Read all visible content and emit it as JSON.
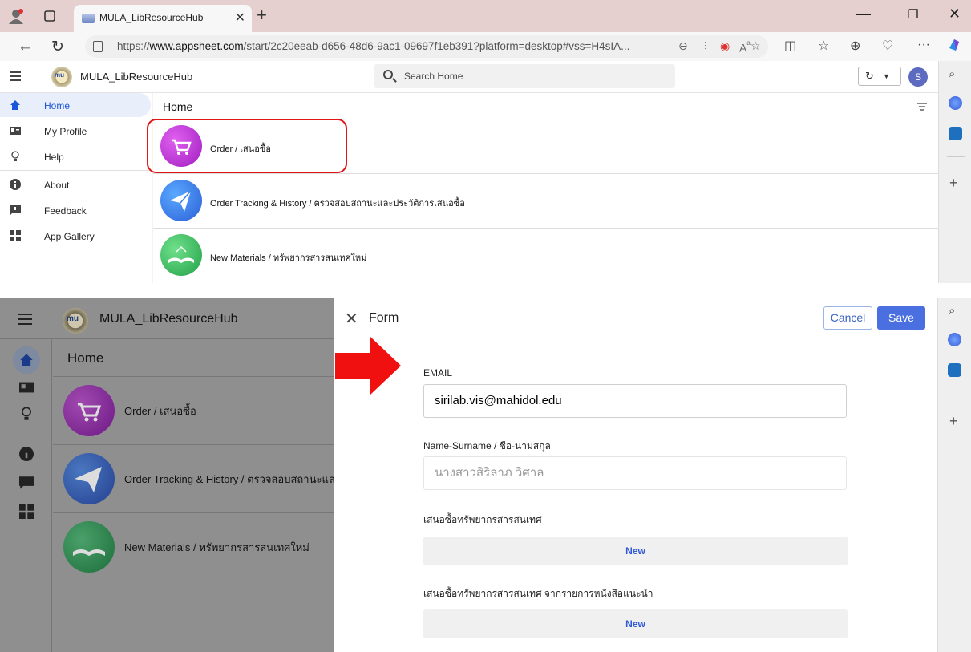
{
  "browser": {
    "tab_title": "MULA_LibResourceHub",
    "url_prefix": "https://",
    "url_domain": "www.appsheet.com",
    "url_rest": "/start/2c20eeab-d656-48d6-9ac1-09697f1eb391?platform=desktop#vss=H4sIA..."
  },
  "app": {
    "name": "MULA_LibResourceHub",
    "logo_text": "mu",
    "search_placeholder": "Search Home",
    "avatar_initial": "S"
  },
  "sidebar": {
    "items": [
      {
        "label": "Home",
        "icon": "home-icon",
        "active": true
      },
      {
        "label": "My Profile",
        "icon": "profile-card-icon"
      },
      {
        "label": "Help",
        "icon": "lightbulb-icon"
      },
      {
        "label": "About",
        "icon": "info-icon"
      },
      {
        "label": "Feedback",
        "icon": "feedback-icon"
      },
      {
        "label": "App Gallery",
        "icon": "grid-icon"
      }
    ]
  },
  "main": {
    "title": "Home",
    "rows": [
      {
        "label": "Order / เสนอซื้อ",
        "icon": "cart-icon",
        "color": "#c02bd6"
      },
      {
        "label": "Order Tracking & History / ตรวจสอบสถานะและประวัติการเสนอซื้อ",
        "icon": "paper-plane-icon",
        "color": "#3f7fe8"
      },
      {
        "label": "New Materials / ทรัพยากรสารสนเทศใหม่",
        "icon": "open-book-icon",
        "color": "#3fbf5f"
      }
    ]
  },
  "bottom_rows": [
    "Order / เสนอซื้อ",
    "Order Tracking & History / ตรวจสอบสถานะแล",
    "New Materials / ทรัพยากรสารสนเทศใหม่"
  ],
  "form": {
    "title": "Form",
    "cancel_label": "Cancel",
    "save_label": "Save",
    "email_label": "EMAIL",
    "email_value": "sirilab.vis@mahidol.edu",
    "name_label": "Name-Surname / ชื่อ-นามสกุล",
    "name_value": "นางสาวสิริลาภ วิศาล",
    "resource_label": "เสนอซื้อทรัพยากรสารสนเทศ",
    "resource_new": "New",
    "recommend_label": "เสนอซื้อทรัพยากรสารสนเทศ จากรายการหนังสือแนะนำ",
    "recommend_new": "New"
  },
  "colors": {
    "accent": "#4a6fe0",
    "highlight": "#e01717"
  }
}
